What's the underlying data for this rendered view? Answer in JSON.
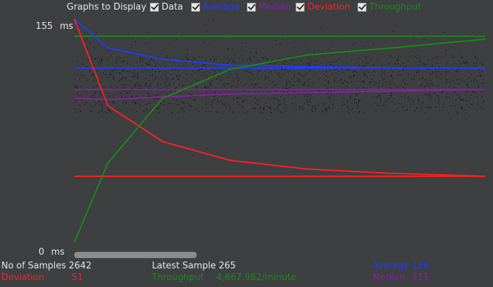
{
  "toolbar": {
    "title": "Graphs to Display",
    "options": [
      {
        "label": "Data",
        "color": "#e8e8e8",
        "checked": true
      },
      {
        "label": "Average",
        "color": "#1f3cff",
        "checked": true
      },
      {
        "label": "Median",
        "color": "#8a1ea6",
        "checked": true
      },
      {
        "label": "Deviation",
        "color": "#ff2020",
        "checked": true
      },
      {
        "label": "Throughput",
        "color": "#1a8a1a",
        "checked": true
      }
    ]
  },
  "axis": {
    "max_value": "155",
    "max_unit": "ms",
    "min_value": "0",
    "min_unit": "ms"
  },
  "stats": {
    "samples_label": "No of Samples",
    "samples_value": "2642",
    "latest_label": "Latest Sample",
    "latest_value": "265",
    "average_label": "Average",
    "average_value": "126",
    "deviation_label": "Deviation",
    "deviation_value": "51",
    "throughput_label": "Throughput",
    "throughput_value": "4,667.982/minute",
    "median_label": "Median",
    "median_value": "111"
  },
  "colors": {
    "data": "#111111",
    "average": "#1f3cff",
    "median": "#8a1ea6",
    "deviation": "#ff2020",
    "throughput": "#1a8a1a"
  },
  "chart_data": {
    "type": "line",
    "ylim": [
      0,
      155
    ],
    "series": [
      {
        "name": "Average",
        "values": [
          160,
          140,
          132,
          128,
          127,
          126,
          126
        ]
      },
      {
        "name": "Median",
        "values": [
          105,
          104,
          106,
          108,
          109,
          110,
          111
        ]
      },
      {
        "name": "Deviation",
        "values": [
          160,
          100,
          75,
          62,
          56,
          53,
          51
        ]
      },
      {
        "name": "Throughput",
        "values": [
          5,
          60,
          105,
          125,
          135,
          140,
          146
        ]
      }
    ]
  }
}
